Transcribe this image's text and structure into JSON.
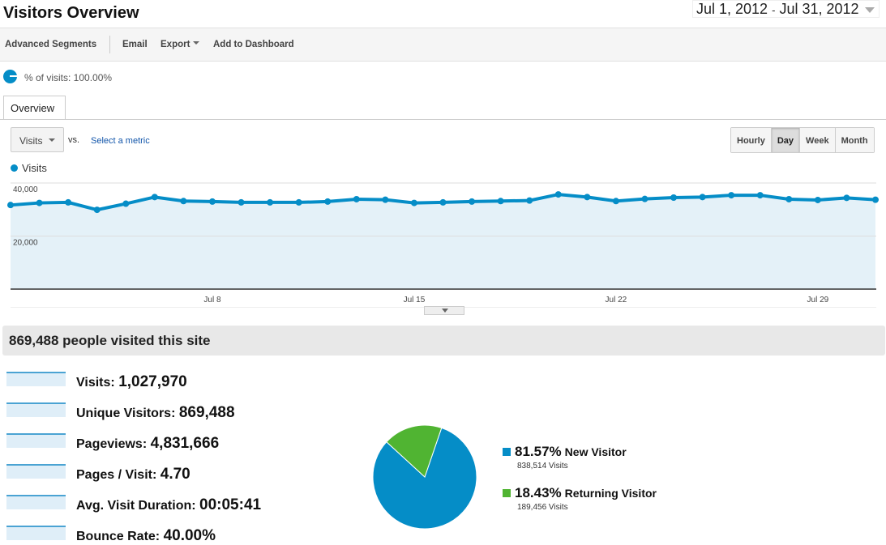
{
  "header": {
    "title": "Visitors Overview",
    "date_start": "Jul 1, 2012",
    "date_sep": "-",
    "date_end": "Jul 31, 2012"
  },
  "toolbar": {
    "advanced_segments": "Advanced Segments",
    "email": "Email",
    "export": "Export",
    "add_to_dashboard": "Add to Dashboard"
  },
  "segment": {
    "text": "% of visits: 100.00%"
  },
  "tabs": [
    {
      "label": "Overview"
    }
  ],
  "controls": {
    "metric": "Visits",
    "vs": "vs.",
    "select_metric": "Select a metric",
    "granularity": [
      "Hourly",
      "Day",
      "Week",
      "Month"
    ],
    "active": "Day"
  },
  "colors": {
    "accent": "#058dc7",
    "returning": "#50b432"
  },
  "chart_data": {
    "type": "area",
    "series": [
      {
        "name": "Visits",
        "values": [
          31700,
          32500,
          32700,
          29900,
          32200,
          34700,
          33200,
          33000,
          32700,
          32700,
          32700,
          33000,
          33900,
          33700,
          32500,
          32700,
          33000,
          33200,
          33400,
          35700,
          34700,
          33200,
          34000,
          34500,
          34700,
          35400,
          35400,
          33900,
          33600,
          34400,
          33700
        ]
      }
    ],
    "x": [
      "Jul 1",
      "Jul 2",
      "Jul 3",
      "Jul 4",
      "Jul 5",
      "Jul 6",
      "Jul 7",
      "Jul 8",
      "Jul 9",
      "Jul 10",
      "Jul 11",
      "Jul 12",
      "Jul 13",
      "Jul 14",
      "Jul 15",
      "Jul 16",
      "Jul 17",
      "Jul 18",
      "Jul 19",
      "Jul 20",
      "Jul 21",
      "Jul 22",
      "Jul 23",
      "Jul 24",
      "Jul 25",
      "Jul 26",
      "Jul 27",
      "Jul 28",
      "Jul 29",
      "Jul 30",
      "Jul 31"
    ],
    "x_ticks": [
      "Jul 8",
      "Jul 15",
      "Jul 22",
      "Jul 29"
    ],
    "y_ticks": [
      "20,000",
      "40,000"
    ],
    "ylim": [
      0,
      40000
    ],
    "legend": "Visits",
    "grid": true
  },
  "summary": {
    "title": "869,488 people visited this site"
  },
  "metrics": [
    {
      "label": "Visits:",
      "value": "1,027,970"
    },
    {
      "label": "Unique Visitors:",
      "value": "869,488"
    },
    {
      "label": "Pageviews:",
      "value": "4,831,666"
    },
    {
      "label": "Pages / Visit:",
      "value": "4.70"
    },
    {
      "label": "Avg. Visit Duration:",
      "value": "00:05:41"
    },
    {
      "label": "Bounce Rate:",
      "value": "40.00%"
    }
  ],
  "pie": [
    {
      "pct": "81.57%",
      "name": "New Visitor",
      "visits": "838,514 Visits",
      "value": 81.57
    },
    {
      "pct": "18.43%",
      "name": "Returning Visitor",
      "visits": "189,456 Visits",
      "value": 18.43
    }
  ]
}
